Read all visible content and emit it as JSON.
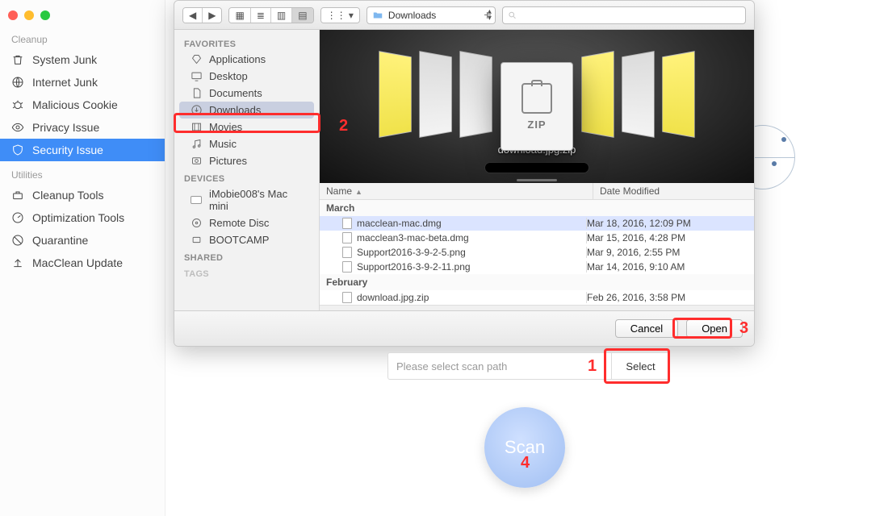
{
  "app_sidebar": {
    "traffic_colors": [
      "#ff5f57",
      "#ffbd2e",
      "#28c940"
    ],
    "sections": {
      "cleanup": {
        "title": "Cleanup",
        "items": [
          {
            "label": "System Junk"
          },
          {
            "label": "Internet Junk"
          },
          {
            "label": "Malicious Cookie"
          },
          {
            "label": "Privacy Issue"
          },
          {
            "label": "Security Issue",
            "active": true
          }
        ]
      },
      "utilities": {
        "title": "Utilities",
        "items": [
          {
            "label": "Cleanup Tools"
          },
          {
            "label": "Optimization Tools"
          },
          {
            "label": "Quarantine"
          },
          {
            "label": "MacClean Update"
          }
        ]
      }
    }
  },
  "finder": {
    "path_label": "Downloads",
    "search_placeholder": "",
    "sidebar": {
      "favorites_header": "FAVORITES",
      "favorites": [
        {
          "label": "Applications"
        },
        {
          "label": "Desktop"
        },
        {
          "label": "Documents"
        },
        {
          "label": "Downloads",
          "selected": true
        },
        {
          "label": "Movies"
        },
        {
          "label": "Music"
        },
        {
          "label": "Pictures"
        }
      ],
      "devices_header": "DEVICES",
      "devices": [
        {
          "label": "iMobie008's Mac mini"
        },
        {
          "label": "Remote Disc"
        },
        {
          "label": "BOOTCAMP"
        }
      ],
      "shared_header": "SHARED",
      "tags_header": "TAGS"
    },
    "coverflow": {
      "center_label": "ZIP",
      "center_caption": "download.jpg.zip"
    },
    "columns": {
      "name": "Name",
      "date": "Date Modified"
    },
    "groups": [
      {
        "label": "March",
        "rows": [
          {
            "name": "macclean-mac.dmg",
            "date": "Mar 18, 2016, 12:09 PM",
            "selected": true
          },
          {
            "name": "macclean3-mac-beta.dmg",
            "date": "Mar 15, 2016, 4:28 PM"
          },
          {
            "name": "Support2016-3-9-2-5.png",
            "date": "Mar 9, 2016, 2:55 PM"
          },
          {
            "name": "Support2016-3-9-2-11.png",
            "date": "Mar 14, 2016, 9:10 AM"
          }
        ]
      },
      {
        "label": "February",
        "rows": [
          {
            "name": "download.jpg.zip",
            "date": "Feb 26, 2016, 3:58 PM"
          }
        ]
      }
    ],
    "buttons": {
      "cancel": "Cancel",
      "open": "Open"
    }
  },
  "scanbar": {
    "placeholder": "Please select scan path",
    "select": "Select"
  },
  "scan_button": "Scan",
  "steps": {
    "1": "1",
    "2": "2",
    "3": "3",
    "4": "4"
  }
}
